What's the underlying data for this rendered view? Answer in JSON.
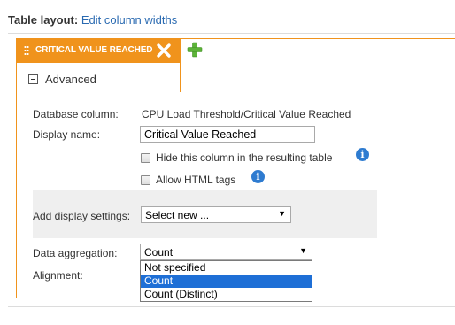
{
  "heading": {
    "label": "Table layout:",
    "link": "Edit column widths"
  },
  "tab": {
    "active_label": "CRITICAL VALUE REACHED"
  },
  "section": {
    "title": "Advanced"
  },
  "fields": {
    "database_column_label": "Database column:",
    "database_column_value": "CPU Load Threshold/Critical Value Reached",
    "display_name_label": "Display name:",
    "display_name_value": "Critical Value Reached",
    "hide_column_label": "Hide this column in the resulting table",
    "allow_html_label": "Allow HTML tags",
    "add_display_settings_label": "Add display settings:",
    "add_display_settings_value": "Select new ...",
    "data_aggregation_label": "Data aggregation:",
    "data_aggregation_value": "Count",
    "alignment_label": "Alignment:"
  },
  "dropdown_options": [
    "Not specified",
    "Count",
    "Count (Distinct)"
  ],
  "dropdown_selected_index": 1,
  "icons": {
    "info": "info-icon",
    "add": "plus-icon",
    "close": "close-icon",
    "grip": "drag-handle-icon",
    "collapse": "collapse-icon",
    "dropdown": "chevron-down-icon"
  },
  "glyphs": {
    "info": "i",
    "arrow": "▼"
  },
  "colors": {
    "accent": "#f0931c",
    "link": "#2a6ab1",
    "info": "#2e7bd0",
    "selection": "#1e6fd6",
    "add": "#5cb338"
  }
}
